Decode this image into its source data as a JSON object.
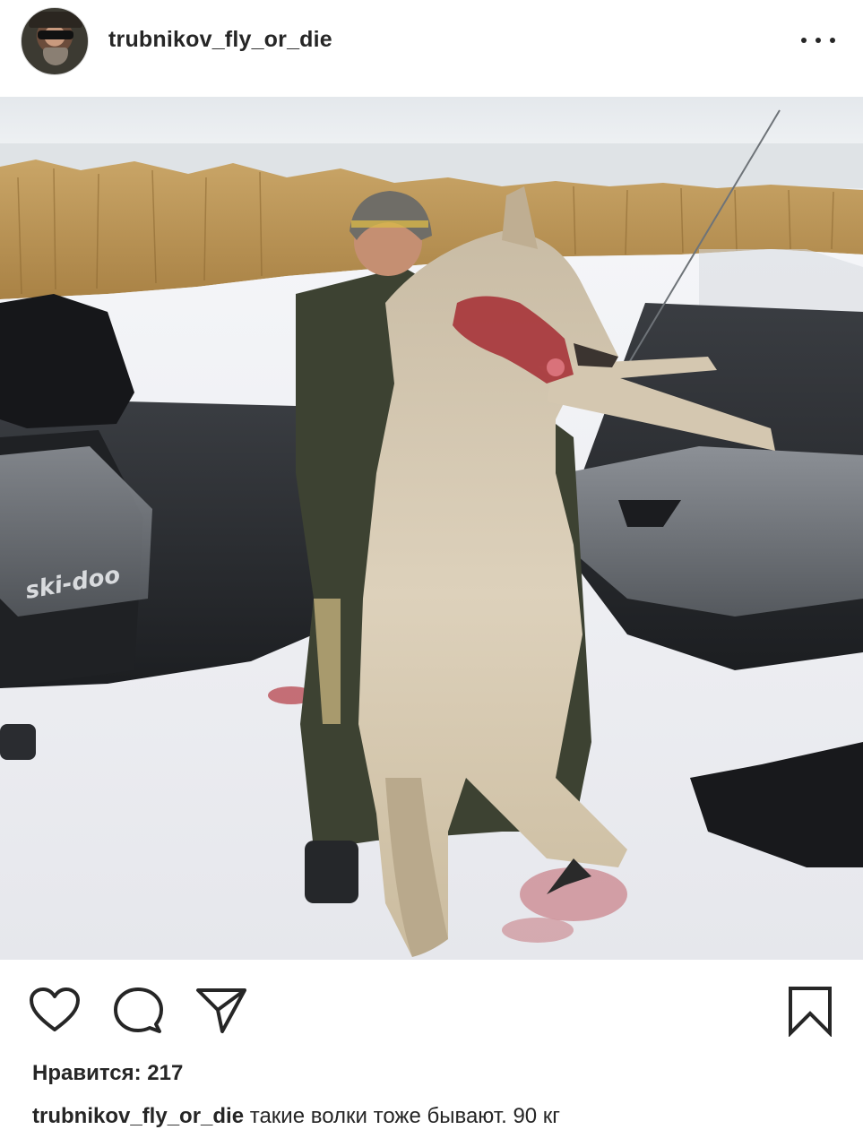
{
  "header": {
    "username": "trubnikov_fly_or_die",
    "more_icon": "more-horizontal-icon"
  },
  "photo": {
    "brand_text": "ski-doo"
  },
  "actions": {
    "like_icon": "heart-icon",
    "comment_icon": "comment-icon",
    "share_icon": "send-icon",
    "save_icon": "bookmark-icon"
  },
  "likes": {
    "label": "Нравится: 217"
  },
  "caption": {
    "username": "trubnikov_fly_or_die",
    "text": "такие волки тоже бывают. 90 кг"
  }
}
